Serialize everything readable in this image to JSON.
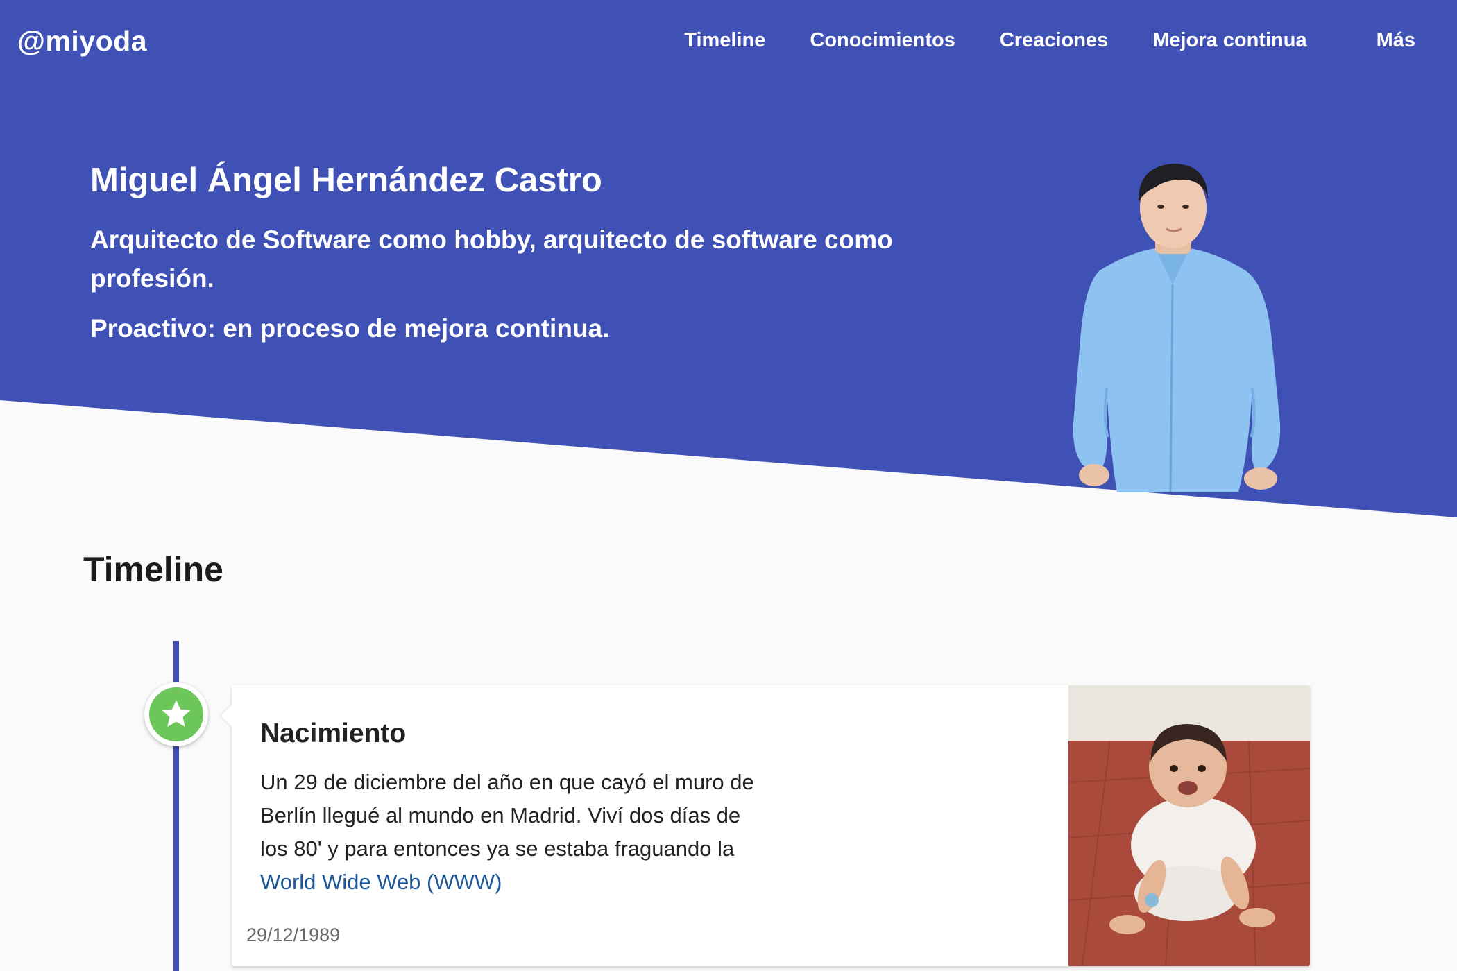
{
  "brand": "@miyoda",
  "nav": [
    "Timeline",
    "Conocimientos",
    "Creaciones",
    "Mejora continua",
    "Más"
  ],
  "hero": {
    "name": "Miguel Ángel Hernández Castro",
    "subtitle": "Arquitecto de Software como hobby, arquitecto de software como profesión.",
    "subtitle2": "Proactivo: en proceso de mejora continua."
  },
  "timeline": {
    "title": "Timeline",
    "entries": [
      {
        "title": "Nacimiento",
        "body_text": "Un 29 de diciembre del año en que cayó el muro de Berlín llegué al mundo en Madrid. Viví dos días de los 80' y para entonces ya se estaba fraguando la ",
        "link_text": "World Wide Web (WWW)",
        "date": "29/12/1989",
        "icon": "star-icon"
      }
    ]
  },
  "colors": {
    "primary": "#3f51b5",
    "marker": "#6cc65a",
    "link": "#1e5799"
  }
}
